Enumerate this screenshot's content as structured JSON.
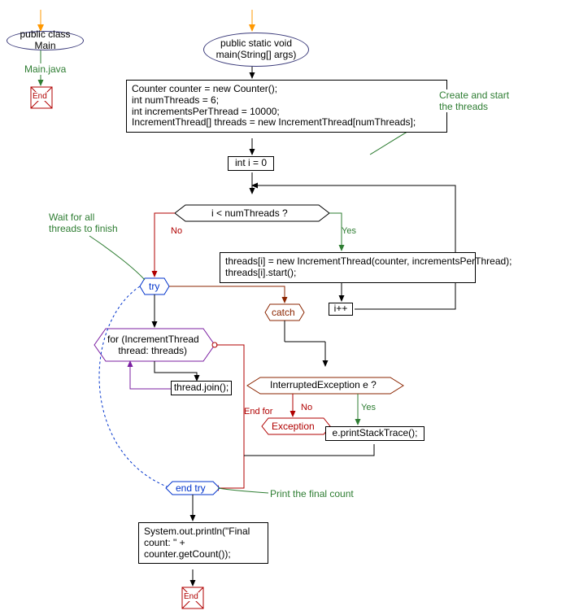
{
  "header": {
    "class_decl": "public class Main",
    "class_file": "Main.java",
    "method_decl": "public static void\nmain(String[] args)"
  },
  "init_block": "Counter counter = new Counter();\nint numThreads = 6;\nint incrementsPerThread = 10000;\nIncrementThread[] threads = new IncrementThread[numThreads];",
  "loop_init": "int i = 0",
  "condition": "i < numThreads ?",
  "loop_body": "threads[i] = new IncrementThread(counter, incrementsPerThread);\nthreads[i].start();",
  "incr": "i++",
  "try_label": "try",
  "for_each": "for (IncrementThread\n    thread: threads)",
  "join_stmt": "thread.join();",
  "catch_label": "catch",
  "catch_cond": "InterruptedException e ?",
  "catch_body": "e.printStackTrace();",
  "exception_label": "Exception",
  "endtry_label": "end try",
  "print_stmt": "System.out.println(\"Final\ncount: \" +\ncounter.getCount());",
  "end_label": "End",
  "comments": {
    "create_start": "Create and start\nthe threads",
    "wait_all": "Wait for all\nthreads to finish",
    "print_final": "Print the final count",
    "end_for": "End for"
  },
  "edges": {
    "yes": "Yes",
    "no": "No"
  },
  "colors": {
    "comment": "#2e7d32",
    "yes": "#2e7d32",
    "no": "#b00000",
    "catch": "#8b2500",
    "try": "#0033cc",
    "for": "#7b1fa2"
  }
}
